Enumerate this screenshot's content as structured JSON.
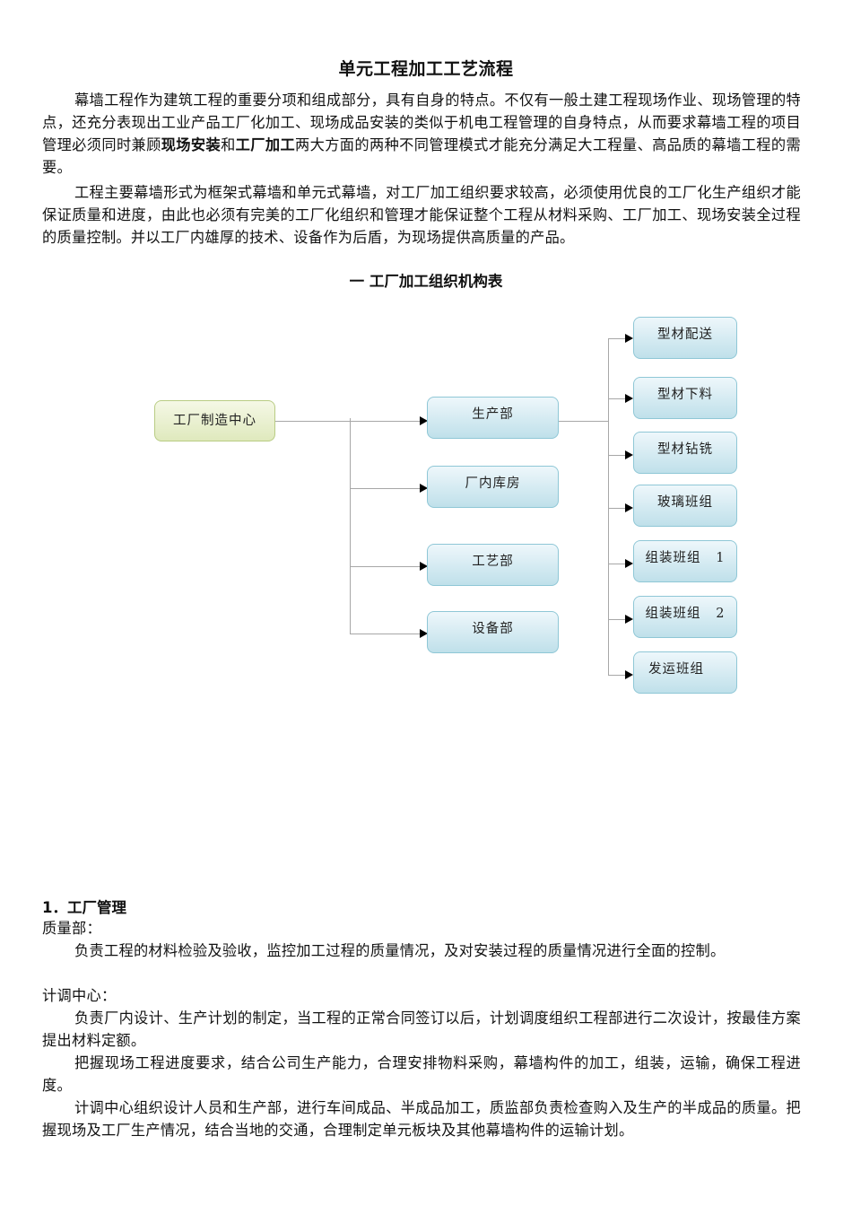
{
  "document": {
    "title": "单元工程加工工艺流程",
    "intro_paragraphs": [
      {
        "parts": [
          {
            "text": "幕墙工程作为建筑工程的重要分项和组成部分，具有自身的特点。不仅有一般土建工程现场作业、现场管理的特点，还充分表现出工业产品工厂化加工、现场成品安装的类似于机电工程管理的自身特点，从而要求幕墙工程的项目管理必须同时兼顾",
            "bold": false
          },
          {
            "text": "现场安装",
            "bold": true
          },
          {
            "text": "和",
            "bold": false
          },
          {
            "text": "工厂加工",
            "bold": true
          },
          {
            "text": "两大方面的两种不同管理模式才能充分满足大工程量、高品质的幕墙工程的需要。",
            "bold": false
          }
        ]
      },
      {
        "text": "工程主要幕墙形式为框架式幕墙和单元式幕墙，对工厂加工组织要求较高，必须使用优良的工厂化生产组织才能保证质量和进度，由此也必须有完美的工厂化组织和管理才能保证整个工程从材料采购、工厂加工、现场安装全过程的质量控制。并以工厂内雄厚的技术、设备作为后盾，为现场提供高质量的产品。"
      }
    ],
    "chart_section_title": "一  工厂加工组织机构表"
  },
  "org_chart": {
    "root": "工厂制造中心",
    "level1": [
      "生产部",
      "厂内库房",
      "工艺部",
      "设备部"
    ],
    "production_children": [
      "型材配送",
      "型材下料",
      "型材钻铣",
      "玻璃班组",
      "组装班组   1",
      "组装班组   2",
      "发运班组"
    ],
    "colors": {
      "root_fill": "#dfe9bd",
      "root_border": "#b9cc84",
      "node_fill": "#bfe0ea",
      "node_border": "#8fc7d6",
      "connector": "#a7a7a7",
      "arrow": "#000000"
    }
  },
  "section1": {
    "heading": "1．工厂管理",
    "quality_label": "质量部：",
    "quality_text": "负责工程的材料检验及验收，监控加工过程的质量情况，及对安装过程的质量情况进行全面的控制。",
    "planning_label": "计调中心：",
    "planning_texts": [
      "负责厂内设计、生产计划的制定，当工程的正常合同签订以后，计划调度组织工程部进行二次设计，按最佳方案提出材料定额。",
      "把握现场工程进度要求，结合公司生产能力，合理安排物料采购，幕墙构件的加工，组装，运输，确保工程进度。",
      "计调中心组织设计人员和生产部，进行车间成品、半成品加工，质监部负责检查购入及生产的半成品的质量。把握现场及工厂生产情况，结合当地的交通，合理制定单元板块及其他幕墙构件的运输计划。"
    ]
  }
}
